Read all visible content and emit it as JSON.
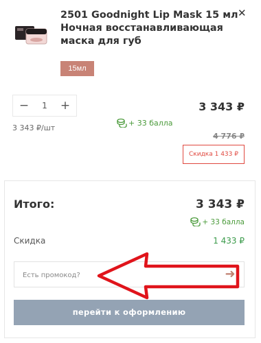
{
  "product": {
    "title": "2501 Goodnight Lip Mask 15 мл Ночная восстанавливающая маска для губ",
    "variant": "15мл",
    "close_icon": "close-icon",
    "quantity": "1",
    "unit_price": "3 343 ₽/шт",
    "bonus": "+ 33 балла",
    "price": "3 343 ₽",
    "old_price": "4 776 ₽",
    "discount": "Скидка  1 433 ₽"
  },
  "summary": {
    "total_label": "Итого:",
    "total_value": "3 343 ₽",
    "bonus": "+ 33 балла",
    "discount_label": "Скидка",
    "discount_value": "1 433 ₽",
    "promo_placeholder": "Есть промокод?",
    "checkout_label": "перейти к оформлению"
  },
  "colors": {
    "variant_bg": "#c88376",
    "bonus_green": "#4a9a3a",
    "discount_red": "#e0473e",
    "checkout_bg": "#94a3b4",
    "annotation_red": "#e0141b"
  }
}
